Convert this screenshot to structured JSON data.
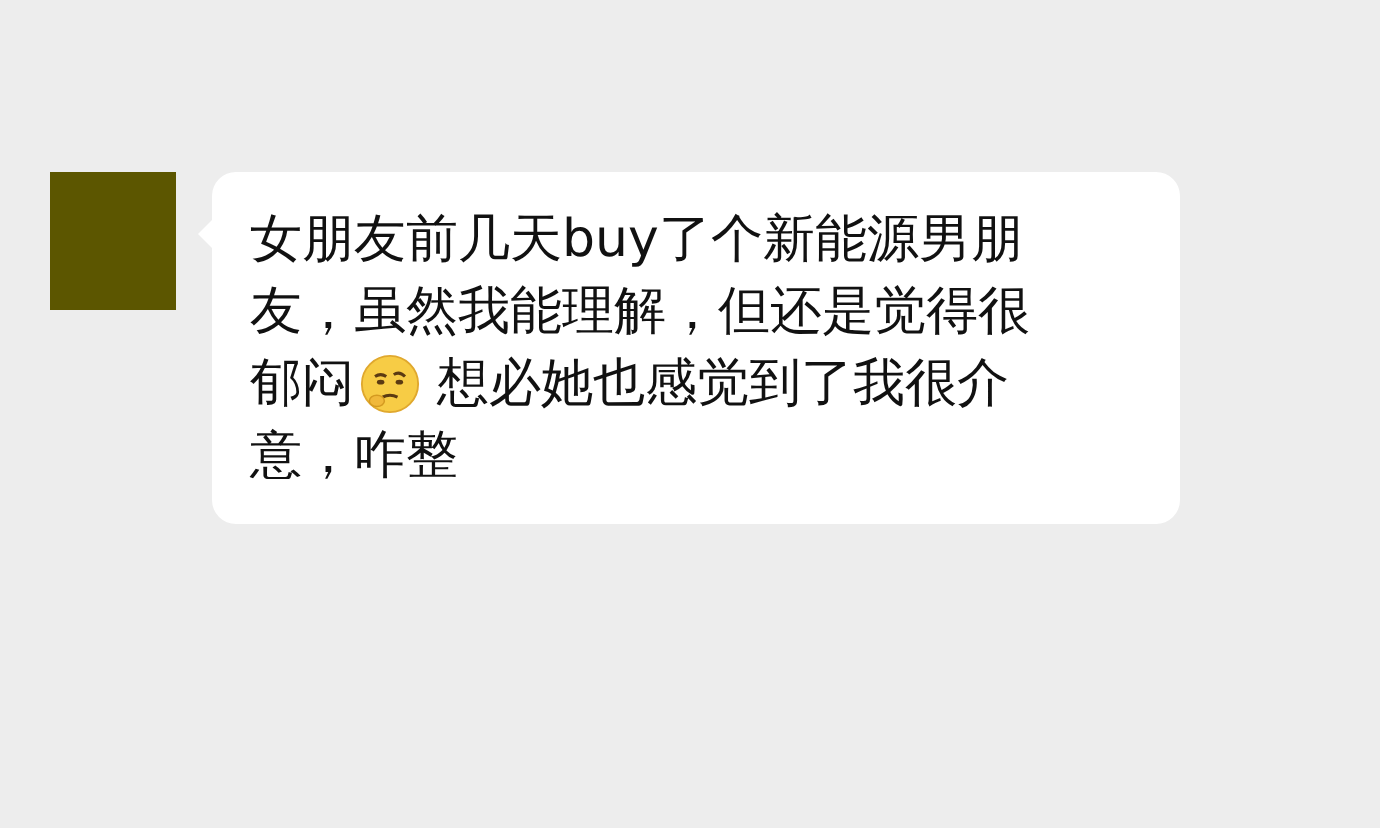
{
  "message": {
    "lines": [
      [
        {
          "kind": "text",
          "text": "女朋友前几天buy了个新能源男朋"
        }
      ],
      [
        {
          "kind": "text",
          "text": "友，虽然我能理解，但还是觉得很"
        }
      ],
      [
        {
          "kind": "text",
          "text": "郁闷"
        },
        {
          "kind": "emoji"
        },
        {
          "kind": "text",
          "text": " 想必她也感觉到了我很介"
        }
      ],
      [
        {
          "kind": "text",
          "text": "意，咋整"
        }
      ]
    ]
  }
}
